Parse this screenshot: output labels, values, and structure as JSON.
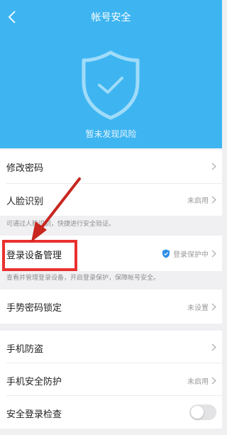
{
  "header": {
    "title": "帐号安全",
    "risk_text": "暂未发现风险"
  },
  "rows": {
    "modify_password": {
      "label": "修改密码"
    },
    "face_recognition": {
      "label": "人脸识别",
      "status": "未启用"
    },
    "face_hint": "可通过人脸识别，快捷进行安全验证。",
    "login_devices": {
      "label": "登录设备管理",
      "status": "登录保护中"
    },
    "login_devices_hint": "查看并管理登录设备，开启登录保护，保障帐号安全。",
    "gesture_lock": {
      "label": "手势密码锁定",
      "status": "未设置"
    },
    "phone_anti_theft": {
      "label": "手机防盗"
    },
    "phone_security": {
      "label": "手机安全防护",
      "status": "未启用"
    },
    "secure_login_check": {
      "label": "安全登录检查"
    }
  },
  "colors": {
    "header_blue": "#3eb5f1",
    "highlight_red": "#e8312f",
    "arrow_red": "#c8261f"
  }
}
